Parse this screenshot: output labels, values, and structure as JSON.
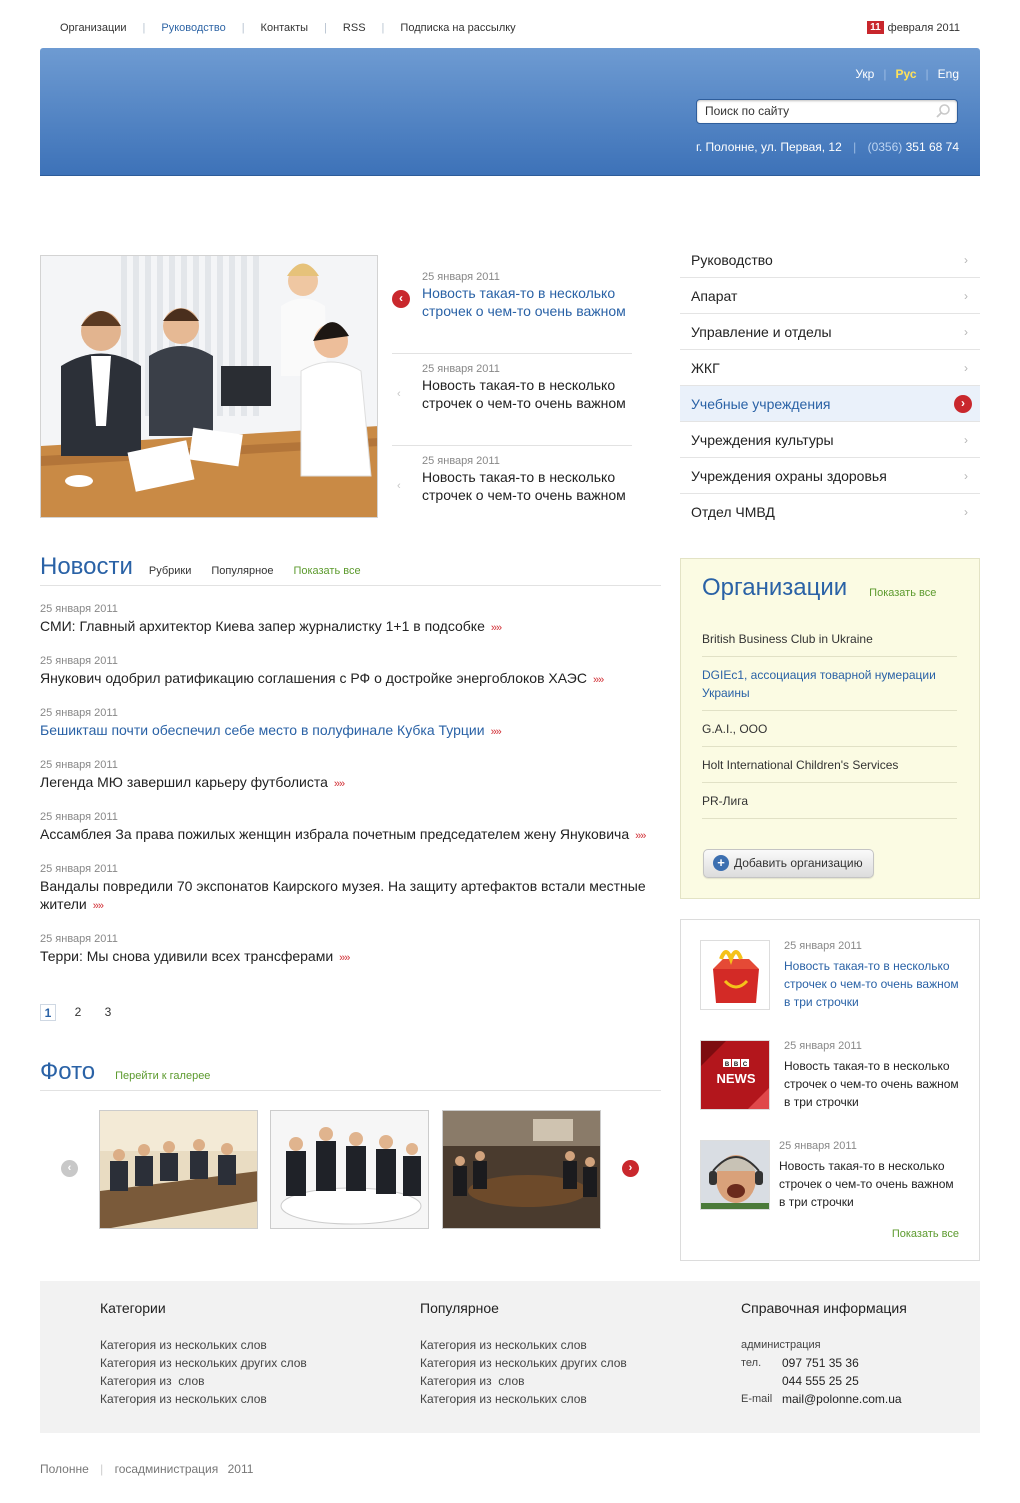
{
  "topnav": {
    "items": [
      {
        "label": "Организации",
        "active": false
      },
      {
        "label": "Руководство",
        "active": true
      },
      {
        "label": "Контакты",
        "active": false
      },
      {
        "label": "RSS",
        "active": false
      },
      {
        "label": "Подписка на рассылку",
        "active": false
      }
    ],
    "date_day": "11",
    "date_rest": "февраля 2011"
  },
  "header": {
    "langs": [
      {
        "label": "Укр",
        "active": false
      },
      {
        "label": "Рус",
        "active": true
      },
      {
        "label": "Eng",
        "active": false
      }
    ],
    "search_placeholder": "Поиск по сайту",
    "address": "г. Полонне, ул. Первая, 12",
    "phone_code": "(0356)",
    "phone_number": "351 68 74"
  },
  "featured": [
    {
      "date": "25 января 2011",
      "title": "Новость такая-то в несколько строчек о чем-то очень важном"
    },
    {
      "date": "25 января 2011",
      "title": "Новость такая-то в несколько строчек о чем-то очень важном"
    },
    {
      "date": "25 января 2011",
      "title": "Новость такая-то в несколько строчек о чем-то очень важном"
    }
  ],
  "right_menu": [
    {
      "label": "Руководство"
    },
    {
      "label": "Апарат"
    },
    {
      "label": "Управление и отделы"
    },
    {
      "label": "ЖКГ"
    },
    {
      "label": "Учебные учреждения"
    },
    {
      "label": "Учреждения культуры"
    },
    {
      "label": "Учреждения охраны здоровья"
    },
    {
      "label": "Отдел ЧМВД"
    }
  ],
  "news": {
    "title": "Новости",
    "tabs": [
      "Рубрики",
      "Популярное"
    ],
    "show_all": "Показать все",
    "items": [
      {
        "date": "25 января 2011",
        "title": "СМИ: Главный архитектор Киева запер журналистку 1+1 в подсобке"
      },
      {
        "date": "25 января 2011",
        "title": "Янукович одобрил ратификацию соглашения с РФ о достройке энергоблоков ХАЭС"
      },
      {
        "date": "25 января 2011",
        "title": "Бешикташ почти обеспечил себе место в полуфинале Кубка Турции"
      },
      {
        "date": "25 января 2011",
        "title": "Легенда МЮ завершил карьеру футболиста"
      },
      {
        "date": "25 января 2011",
        "title": "Ассамблея За права пожилых женщин избрала почетным председателем жену Януковича"
      },
      {
        "date": "25 января 2011",
        "title": "Вандалы повредили 70 экспонатов Каирского музея. На защиту артефактов встали местные жители"
      },
      {
        "date": "25 января 2011",
        "title": "Терри: Мы снова удивили всех трансферами"
      }
    ],
    "more": "»»",
    "pages": [
      "1",
      "2",
      "3"
    ]
  },
  "photo": {
    "title": "Фото",
    "gallery_link": "Перейти к галерее"
  },
  "orgs": {
    "title": "Организации",
    "show_all": "Показать все",
    "items": [
      {
        "label": "British Business Club in Ukraine"
      },
      {
        "label": "DGIEc1, ассоциация товарной нумерации Украины"
      },
      {
        "label": "G.A.I., ООО"
      },
      {
        "label": "Holt International Children's Services"
      },
      {
        "label": "PR-Лига"
      }
    ],
    "add_button": "Добавить организацию"
  },
  "side_news": {
    "items": [
      {
        "date": "25 января 2011",
        "title": "Новость такая-то в несколько строчек о чем-то очень важном в три строчки"
      },
      {
        "date": "25 января 2011",
        "title": "Новость такая-то в несколько строчек о чем-то очень важном в три строчки"
      },
      {
        "date": "25 января 2011",
        "title": "Новость такая-то в несколько строчек о чем-то очень важном в три строчки"
      }
    ],
    "bbc_text": "BBC",
    "news_text": "NEWS",
    "show_all": "Показать все"
  },
  "footer": {
    "col1": {
      "title": "Категории",
      "links": [
        "Категория из нескольких слов",
        "Категория из нескольких других слов",
        "Категория из  слов",
        "Категория из нескольких слов"
      ]
    },
    "col2": {
      "title": "Популярное",
      "links": [
        "Категория из нескольких слов",
        "Категория из нескольких других слов",
        "Категория из  слов",
        "Категория из нескольких слов"
      ]
    },
    "col3": {
      "title": "Справочная информация",
      "admin": "администрация",
      "tel_label": "тел.",
      "tel1": "097 751 35 36",
      "tel2": "044 555 25 25",
      "email_label": "E-mail",
      "email": "mail@polonne.com.ua"
    },
    "copyright": [
      "Полонне",
      "госадминистрация",
      "2011"
    ]
  },
  "colors": {
    "accent_blue": "#2a62a6",
    "header_top": "#6e9bd2",
    "header_bottom": "#3d72b8",
    "red": "#c9282d",
    "green_link": "#5c9a2d",
    "orgs_bg": "#fbfbe3",
    "footer_bg": "#f2f2f2"
  }
}
